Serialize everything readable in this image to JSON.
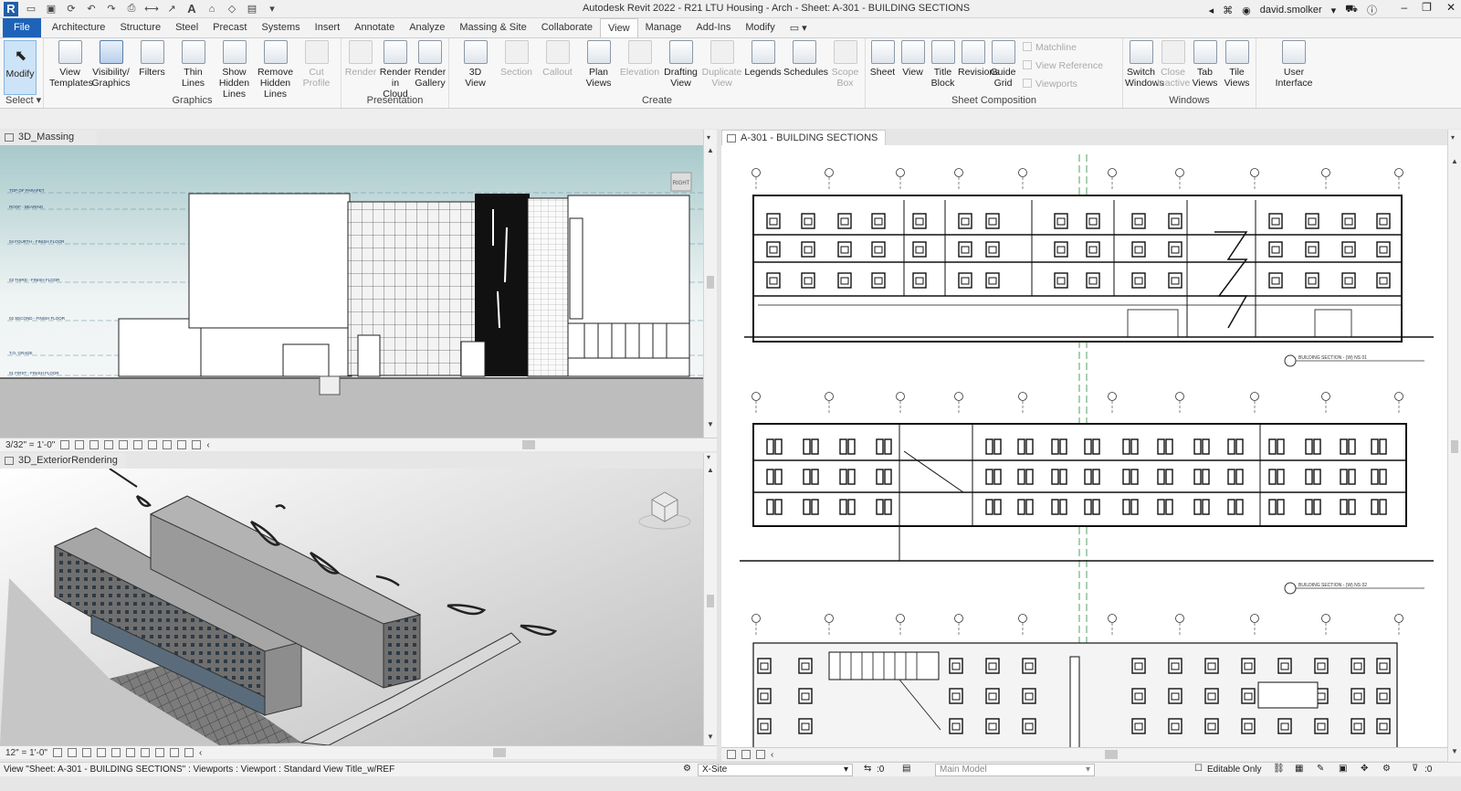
{
  "window": {
    "title": "Autodesk Revit 2022 - R21 LTU Housing - Arch - Sheet: A-301 - BUILDING SECTIONS",
    "user": "david.smolker",
    "logo": "R"
  },
  "tabs": [
    {
      "label": "File",
      "kind": "file"
    },
    {
      "label": "Architecture"
    },
    {
      "label": "Structure"
    },
    {
      "label": "Steel"
    },
    {
      "label": "Precast"
    },
    {
      "label": "Systems"
    },
    {
      "label": "Insert"
    },
    {
      "label": "Annotate"
    },
    {
      "label": "Analyze"
    },
    {
      "label": "Massing & Site"
    },
    {
      "label": "Collaborate"
    },
    {
      "label": "View",
      "active": true
    },
    {
      "label": "Manage"
    },
    {
      "label": "Add-Ins"
    },
    {
      "label": "Modify"
    }
  ],
  "ribbon": {
    "select": {
      "modify": "Modify",
      "title": "Select"
    },
    "graphics": {
      "title": "Graphics",
      "buttons": [
        "View\nTemplates",
        "Visibility/\nGraphics",
        "Filters",
        "Thin\nLines",
        "Show\nHidden Lines",
        "Remove\nHidden Lines",
        "Cut\nProfile"
      ]
    },
    "presentation": {
      "title": "Presentation",
      "buttons": [
        "Render",
        "Render\nin Cloud",
        "Render\nGallery"
      ]
    },
    "create": {
      "title": "Create",
      "buttons": [
        "3D\nView",
        "Section",
        "Callout",
        "Plan\nViews",
        "Elevation",
        "Drafting\nView",
        "Duplicate\nView",
        "Legends",
        "Schedules",
        "Scope\nBox"
      ]
    },
    "sheet_composition": {
      "title": "Sheet Composition",
      "buttons": [
        "Sheet",
        "View",
        "Title\nBlock",
        "Revisions",
        "Guide\nGrid"
      ],
      "small": [
        "Matchline",
        "View  Reference",
        "Viewports"
      ]
    },
    "windows": {
      "title": "Windows",
      "buttons": [
        "Switch\nWindows",
        "Close\nInactive",
        "Tab\nViews",
        "Tile\nViews"
      ]
    },
    "user_interface": {
      "label": "User\nInterface"
    }
  },
  "views": {
    "massing": {
      "title": "3D_Massing",
      "scale": "3/32\" = 1'-0\"",
      "viewcube": "RIGHT",
      "levels": [
        "TOP OF PARAPET",
        "ROOF - BEARING",
        "04 FOURTH - FINISH FLOOR",
        "03 THIRD - FINISH FLOOR",
        "02 SECOND - FINISH FLOOR",
        "T.O. GRADE",
        "01 FIRST - FINISH FLOOR"
      ]
    },
    "exterior": {
      "title": "3D_ExteriorRendering",
      "scale": "12\" = 1'-0\""
    },
    "sheet": {
      "title": "A-301 - BUILDING SECTIONS",
      "section_labels": [
        "BUILDING SECTION - (W) NS 01",
        "BUILDING SECTION - (W) NS 02"
      ]
    }
  },
  "statusbar": {
    "message": "View \"Sheet: A-301 - BUILDING SECTIONS\" : Viewports : Viewport : Standard View Title_w/REF",
    "workset": "X-Site",
    "count": ":0",
    "model": "Main Model",
    "editable": "Editable Only",
    "filter_count": ":0"
  },
  "colors": {
    "file_tab": "#1e63b8",
    "accent": "#1f5fa8",
    "modify_active": "#cde3f7"
  }
}
